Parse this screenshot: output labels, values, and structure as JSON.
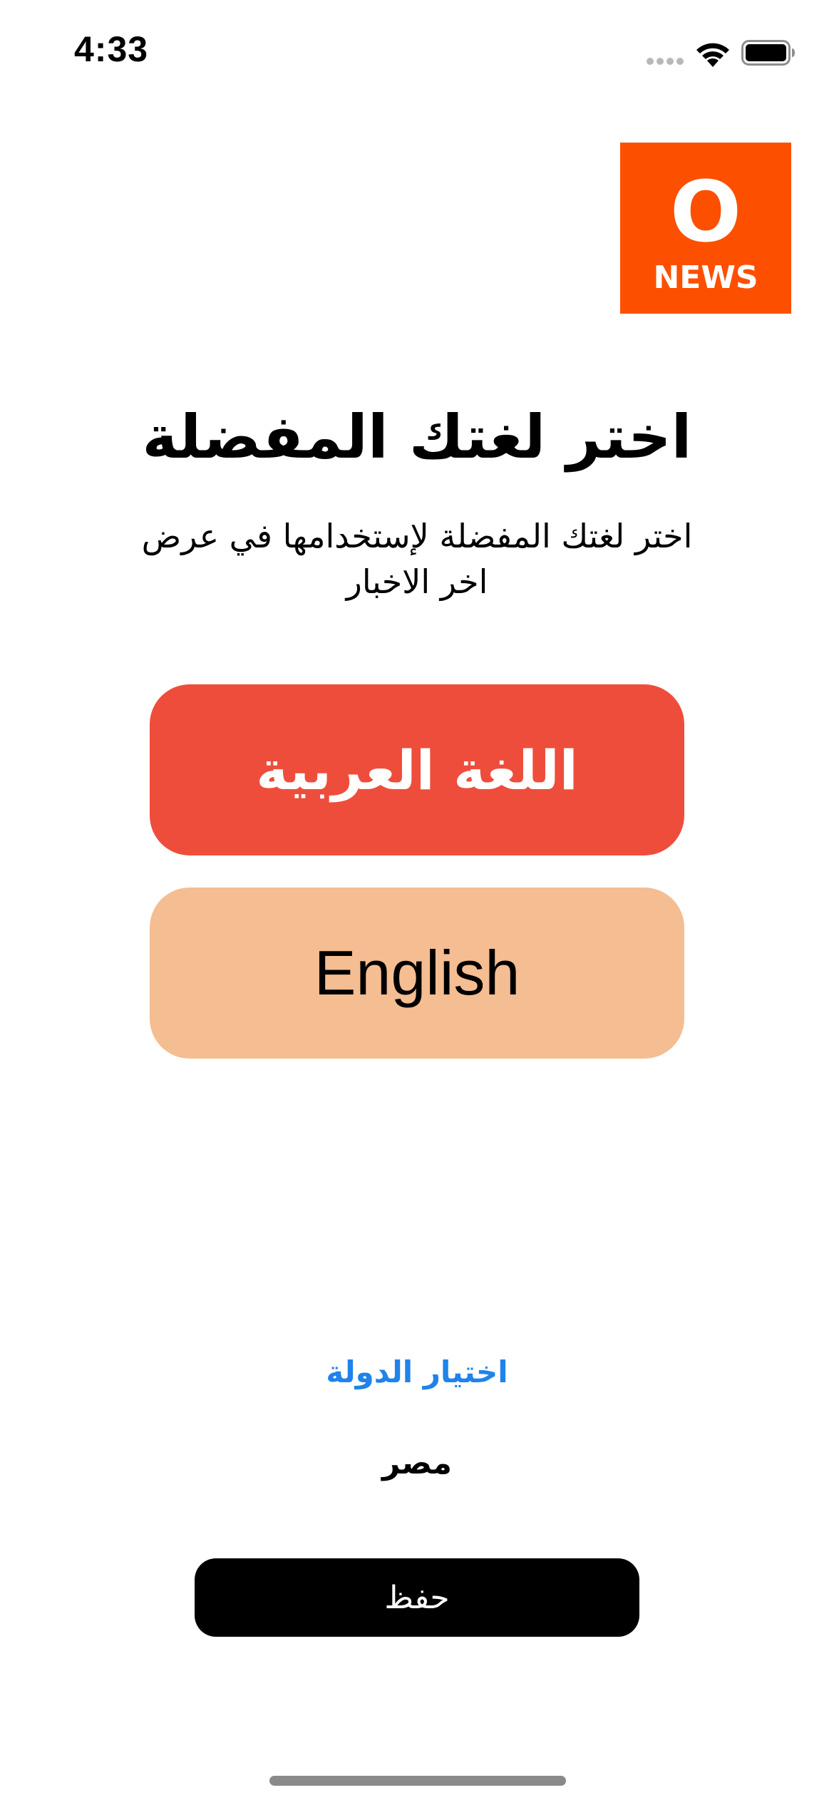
{
  "status_bar": {
    "time": "4:33"
  },
  "logo": {
    "letter": "O",
    "word": "NEWS",
    "color": "#fd4f00"
  },
  "header": {
    "title": "اختر لغتك المفضلة",
    "subtitle_line1": "اختر لغتك المفضلة لإستخدامها في عرض",
    "subtitle_line2": "اخر الاخبار"
  },
  "languages": {
    "arabic_label": "اللغة العربية",
    "arabic_color": "#ef4d3b",
    "english_label": "English",
    "english_color": "#f5bd92"
  },
  "country": {
    "select_label": "اختيار الدولة",
    "link_color": "#1f83ea",
    "selected_value": "مصر"
  },
  "actions": {
    "save_label": "حفظ"
  }
}
